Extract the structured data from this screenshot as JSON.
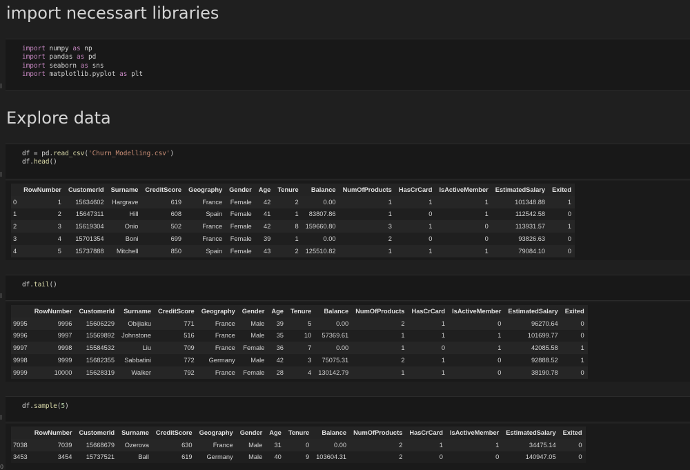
{
  "sections": {
    "libs_title": "import necessart libraries",
    "explore_title": "Explore data"
  },
  "imports": [
    {
      "kw": "import",
      "mod": " numpy ",
      "as": "as",
      "alias": " np"
    },
    {
      "kw": "import",
      "mod": " pandas ",
      "as": "as",
      "alias": " pd"
    },
    {
      "kw": "import",
      "mod": " seaborn ",
      "as": "as",
      "alias": " sns"
    },
    {
      "kw": "import",
      "mod": " matplotlib.pyplot ",
      "as": "as",
      "alias": " plt"
    }
  ],
  "read_cell": {
    "l1a": "df = pd.",
    "l1fn": "read_csv",
    "l1b": "(",
    "l1str": "'Churn_Modelling.csv'",
    "l1c": ")",
    "l2a": "df.",
    "l2fn": "head",
    "l2b": "()"
  },
  "tail_cell": {
    "a": "df.",
    "fn": "tail",
    "b": "()"
  },
  "sample_cell": {
    "a": "df.",
    "fn": "sample",
    "b": "(",
    "num": "5",
    "c": ")"
  },
  "columns": [
    "",
    "RowNumber",
    "CustomerId",
    "Surname",
    "CreditScore",
    "Geography",
    "Gender",
    "Age",
    "Tenure",
    "Balance",
    "NumOfProducts",
    "HasCrCard",
    "IsActiveMember",
    "EstimatedSalary",
    "Exited"
  ],
  "head_rows": [
    [
      "0",
      "1",
      "15634602",
      "Hargrave",
      "619",
      "France",
      "Female",
      "42",
      "2",
      "0.00",
      "1",
      "1",
      "1",
      "101348.88",
      "1"
    ],
    [
      "1",
      "2",
      "15647311",
      "Hill",
      "608",
      "Spain",
      "Female",
      "41",
      "1",
      "83807.86",
      "1",
      "0",
      "1",
      "112542.58",
      "0"
    ],
    [
      "2",
      "3",
      "15619304",
      "Onio",
      "502",
      "France",
      "Female",
      "42",
      "8",
      "159660.80",
      "3",
      "1",
      "0",
      "113931.57",
      "1"
    ],
    [
      "3",
      "4",
      "15701354",
      "Boni",
      "699",
      "France",
      "Female",
      "39",
      "1",
      "0.00",
      "2",
      "0",
      "0",
      "93826.63",
      "0"
    ],
    [
      "4",
      "5",
      "15737888",
      "Mitchell",
      "850",
      "Spain",
      "Female",
      "43",
      "2",
      "125510.82",
      "1",
      "1",
      "1",
      "79084.10",
      "0"
    ]
  ],
  "tail_rows": [
    [
      "9995",
      "9996",
      "15606229",
      "Obijiaku",
      "771",
      "France",
      "Male",
      "39",
      "5",
      "0.00",
      "2",
      "1",
      "0",
      "96270.64",
      "0"
    ],
    [
      "9996",
      "9997",
      "15569892",
      "Johnstone",
      "516",
      "France",
      "Male",
      "35",
      "10",
      "57369.61",
      "1",
      "1",
      "1",
      "101699.77",
      "0"
    ],
    [
      "9997",
      "9998",
      "15584532",
      "Liu",
      "709",
      "France",
      "Female",
      "36",
      "7",
      "0.00",
      "1",
      "0",
      "1",
      "42085.58",
      "1"
    ],
    [
      "9998",
      "9999",
      "15682355",
      "Sabbatini",
      "772",
      "Germany",
      "Male",
      "42",
      "3",
      "75075.31",
      "2",
      "1",
      "0",
      "92888.52",
      "1"
    ],
    [
      "9999",
      "10000",
      "15628319",
      "Walker",
      "792",
      "France",
      "Female",
      "28",
      "4",
      "130142.79",
      "1",
      "1",
      "0",
      "38190.78",
      "0"
    ]
  ],
  "sample_rows": [
    [
      "7038",
      "7039",
      "15668679",
      "Ozerova",
      "630",
      "France",
      "Male",
      "31",
      "0",
      "0.00",
      "2",
      "1",
      "1",
      "34475.14",
      "0"
    ],
    [
      "3453",
      "3454",
      "15737521",
      "Ball",
      "619",
      "Germany",
      "Male",
      "40",
      "9",
      "103604.31",
      "2",
      "0",
      "0",
      "140947.05",
      "0"
    ]
  ],
  "corner_text": "0"
}
